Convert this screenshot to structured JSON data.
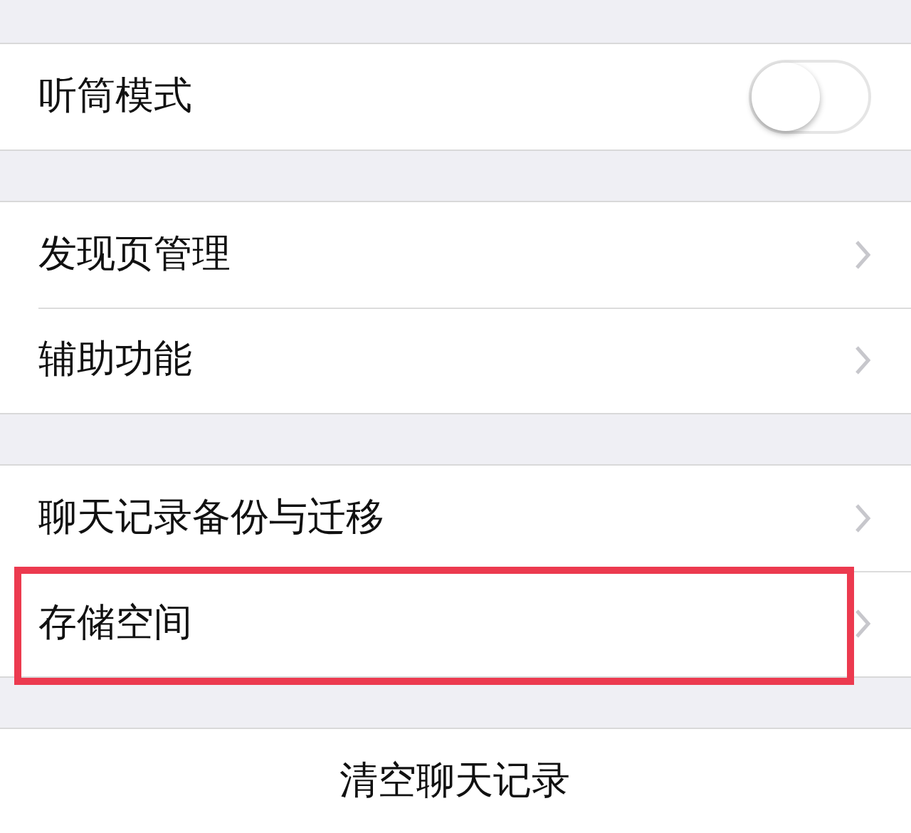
{
  "sections": [
    {
      "rows": [
        {
          "kind": "toggle",
          "label": "听筒模式",
          "on": false,
          "highlighted": false
        }
      ]
    },
    {
      "rows": [
        {
          "kind": "link",
          "label": "发现页管理",
          "highlighted": false
        },
        {
          "kind": "link",
          "label": "辅助功能",
          "highlighted": false
        }
      ]
    },
    {
      "rows": [
        {
          "kind": "link",
          "label": "聊天记录备份与迁移",
          "highlighted": false
        },
        {
          "kind": "link",
          "label": "存储空间",
          "highlighted": true
        }
      ]
    },
    {
      "rows": [
        {
          "kind": "action",
          "label": "清空聊天记录",
          "highlighted": false
        }
      ]
    }
  ]
}
